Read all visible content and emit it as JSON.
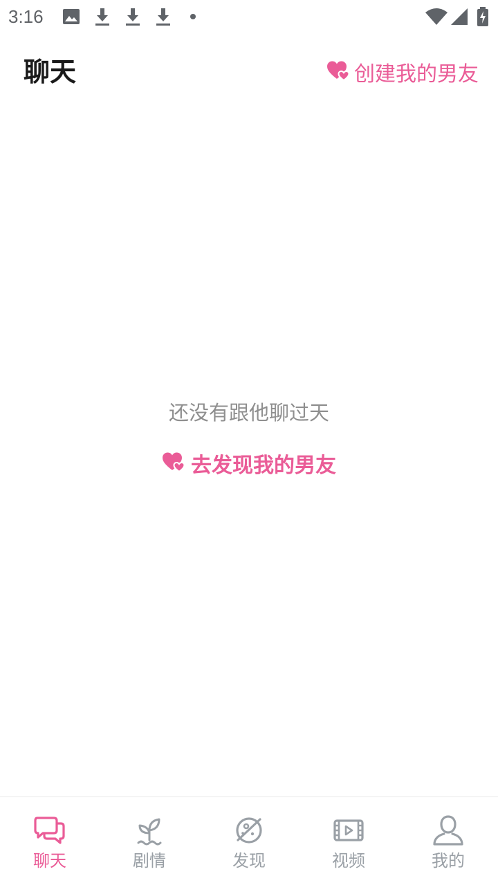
{
  "status_bar": {
    "time": "3:16"
  },
  "header": {
    "title": "聊天",
    "create_label": "创建我的男友"
  },
  "empty_state": {
    "message": "还没有跟他聊过天",
    "discover_label": "去发现我的男友"
  },
  "bottom_nav": {
    "items": [
      {
        "label": "聊天",
        "icon": "chat-icon",
        "active": true
      },
      {
        "label": "剧情",
        "icon": "sprout-icon",
        "active": false
      },
      {
        "label": "发现",
        "icon": "planet-icon",
        "active": false
      },
      {
        "label": "视频",
        "icon": "film-icon",
        "active": false
      },
      {
        "label": "我的",
        "icon": "profile-icon",
        "active": false
      }
    ]
  },
  "colors": {
    "accent": "#ea5c97",
    "inactive": "#9aa0a6",
    "title": "#1a1a1a",
    "muted_text": "#8f8f8f"
  }
}
